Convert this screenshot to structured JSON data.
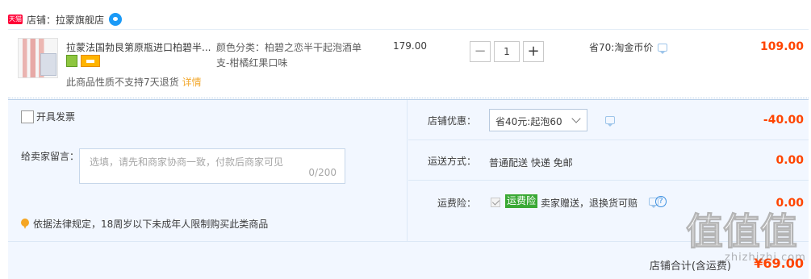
{
  "store": {
    "badge": "天猫",
    "label": "店铺：拉蒙旗舰店"
  },
  "item": {
    "title": "拉蒙法国勃艮第原瓶进口柏碧半...",
    "sku_line1": "颜色分类：柏碧之恋半干起泡酒单",
    "sku_line2": "支-柑橘红果口味",
    "unit_price": "179.00",
    "quantity": "1",
    "qty_minus": "−",
    "qty_plus": "+",
    "saving": "省70:淘金币价",
    "total": "109.00",
    "no_return_text": "此商品性质不支持7天退货",
    "detail_link": "详情"
  },
  "invoice": {
    "label": "开具发票"
  },
  "message": {
    "label": "给卖家留言：",
    "placeholder": "选填，请先和商家协商一致，付款后商家可见",
    "counter": "0/200"
  },
  "law_note": "依据法律规定，18周岁以下未成年人限制购买此类商品",
  "discount": {
    "label": "店铺优惠：",
    "selected": "省40元:起泡60",
    "value": "-40.00"
  },
  "shipping": {
    "label": "运送方式：",
    "info": "普通配送 快递 免邮",
    "value": "0.00"
  },
  "freight_insurance": {
    "label": "运费险：",
    "tag": "运费险",
    "text": "卖家赠送，退换货可赔",
    "value": "0.00"
  },
  "subtotal": {
    "label": "店铺合计(含运费)",
    "value": "¥69.00"
  },
  "watermark": {
    "mark": "值值值",
    "url": "zhizhizhi.com"
  },
  "colors": {
    "price_red": "#ff4400",
    "panel_bg": "#f2f7ff",
    "insurance_green": "#3aa935",
    "tmall_red": "#ff0036"
  }
}
